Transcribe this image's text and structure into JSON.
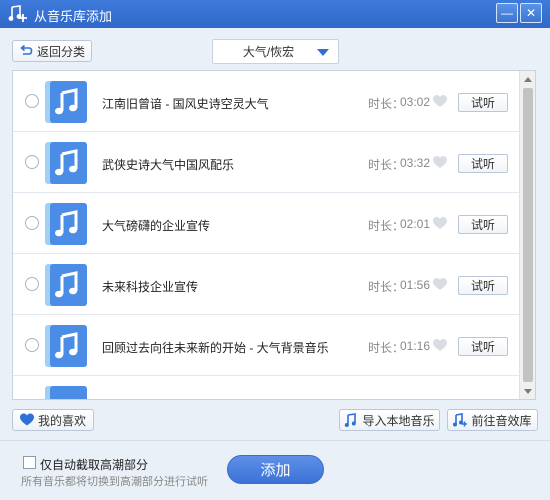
{
  "window": {
    "title": "从音乐库添加",
    "minimize_glyph": "—",
    "close_glyph": "✕"
  },
  "toolbar": {
    "back_label": "返回分类",
    "category_selected": "大气/恢宏"
  },
  "list": {
    "duration_prefix": "时长：",
    "listen_label": "试听",
    "items": [
      {
        "name": "江南旧曾谙 - 国风史诗空灵大气",
        "duration": "03:02"
      },
      {
        "name": "武侠史诗大气中国风配乐",
        "duration": "03:32"
      },
      {
        "name": "大气磅礴的企业宣传",
        "duration": "02:01"
      },
      {
        "name": "未来科技企业宣传",
        "duration": "01:56"
      },
      {
        "name": "回顾过去向往未来新的开始 - 大气背景音乐",
        "duration": "01:16"
      }
    ]
  },
  "actions": {
    "favorites_label": "我的喜欢",
    "import_label": "导入本地音乐",
    "store_label": "前往音效库"
  },
  "footer": {
    "checkbox_label": "仅自动截取高潮部分",
    "hint": "所有音乐都将切换到高潮部分进行试听",
    "add_label": "添加"
  },
  "colors": {
    "titlebar": "#3573d6",
    "accent": "#3b72d6",
    "thumb_light": "#9fd1f7",
    "thumb_dark": "#4a8ce6"
  },
  "icons": {
    "app": "music-add-icon",
    "back": "back-arrow-icon",
    "favorite": "heart-icon",
    "import": "music-note-icon",
    "store": "music-store-icon",
    "track": "music-note-icon"
  }
}
